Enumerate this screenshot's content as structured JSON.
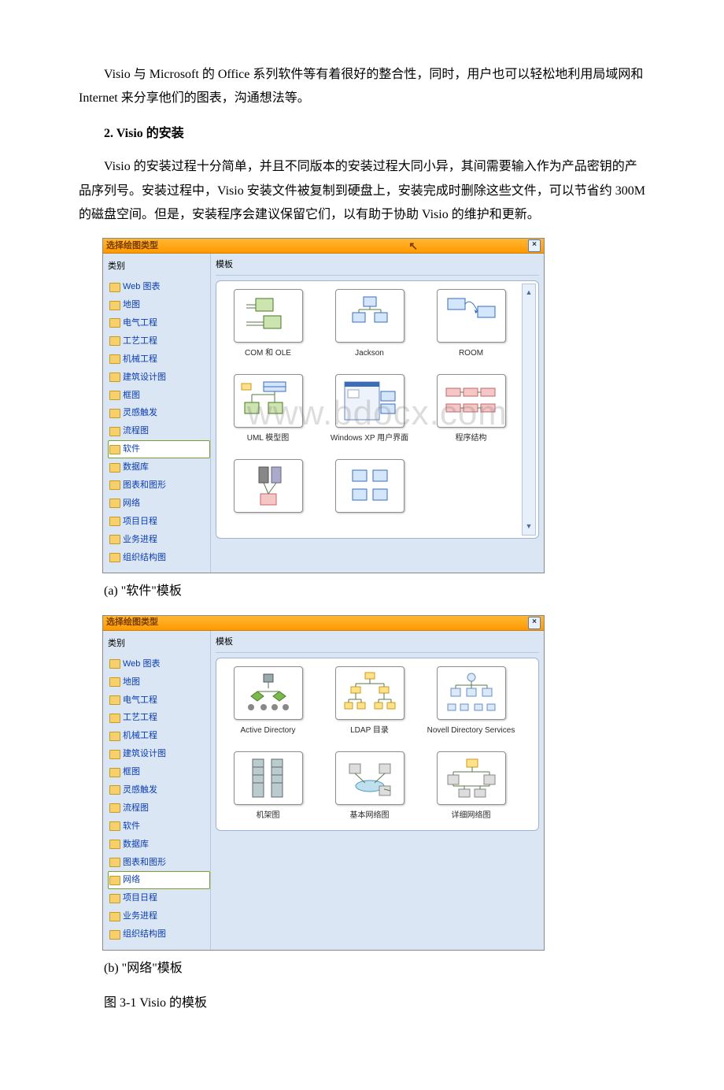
{
  "paragraphs": {
    "p1": "Visio 与 Microsoft 的 Office 系列软件等有着很好的整合性，同时，用户也可以轻松地利用局域网和 Internet 来分享他们的图表，沟通想法等。",
    "heading": "2. Visio 的安装",
    "p2": "Visio 的安装过程十分简单，并且不同版本的安装过程大同小异，其间需要输入作为产品密钥的产品序列号。安装过程中，Visio 安装文件被复制到硬盘上，安装完成时删除这些文件，可以节省约 300M 的磁盘空间。但是，安装程序会建议保留它们，以有助于协助 Visio 的维护和更新。",
    "cap_a": "(a) \"软件\"模板",
    "cap_b": "(b) \"网络\"模板",
    "fig": "图 3-1 Visio 的模板"
  },
  "dialog": {
    "title": "选择绘图类型",
    "close": "×",
    "cat_header": "类别",
    "tpl_header": "模板"
  },
  "categories_a": [
    {
      "label": "Web 图表",
      "sel": false
    },
    {
      "label": "地图",
      "sel": false
    },
    {
      "label": "电气工程",
      "sel": false
    },
    {
      "label": "工艺工程",
      "sel": false
    },
    {
      "label": "机械工程",
      "sel": false
    },
    {
      "label": "建筑设计图",
      "sel": false
    },
    {
      "label": "框图",
      "sel": false
    },
    {
      "label": "灵感触发",
      "sel": false
    },
    {
      "label": "流程图",
      "sel": false
    },
    {
      "label": "软件",
      "sel": true
    },
    {
      "label": "数据库",
      "sel": false
    },
    {
      "label": "图表和图形",
      "sel": false
    },
    {
      "label": "网络",
      "sel": false
    },
    {
      "label": "项目日程",
      "sel": false
    },
    {
      "label": "业务进程",
      "sel": false
    },
    {
      "label": "组织结构图",
      "sel": false
    }
  ],
  "categories_b": [
    {
      "label": "Web 图表",
      "sel": false
    },
    {
      "label": "地图",
      "sel": false
    },
    {
      "label": "电气工程",
      "sel": false
    },
    {
      "label": "工艺工程",
      "sel": false
    },
    {
      "label": "机械工程",
      "sel": false
    },
    {
      "label": "建筑设计图",
      "sel": false
    },
    {
      "label": "框图",
      "sel": false
    },
    {
      "label": "灵感触发",
      "sel": false
    },
    {
      "label": "流程图",
      "sel": false
    },
    {
      "label": "软件",
      "sel": false
    },
    {
      "label": "数据库",
      "sel": false
    },
    {
      "label": "图表和图形",
      "sel": false
    },
    {
      "label": "网络",
      "sel": true
    },
    {
      "label": "项目日程",
      "sel": false
    },
    {
      "label": "业务进程",
      "sel": false
    },
    {
      "label": "组织结构图",
      "sel": false
    }
  ],
  "templates_a": [
    {
      "label": "COM 和 OLE",
      "icon": "com"
    },
    {
      "label": "Jackson",
      "icon": "jackson"
    },
    {
      "label": "ROOM",
      "icon": "room"
    },
    {
      "label": "UML 模型图",
      "icon": "uml"
    },
    {
      "label": "Windows XP 用户界面",
      "icon": "winxp"
    },
    {
      "label": "程序结构",
      "icon": "prog"
    },
    {
      "label": "",
      "icon": "enterprise"
    },
    {
      "label": "",
      "icon": "boxes"
    }
  ],
  "templates_b": [
    {
      "label": "Active Directory",
      "icon": "ad"
    },
    {
      "label": "LDAP 目录",
      "icon": "ldap"
    },
    {
      "label": "Novell Directory Services",
      "icon": "nds"
    },
    {
      "label": "机架图",
      "icon": "rack"
    },
    {
      "label": "基本网络图",
      "icon": "basicnet"
    },
    {
      "label": "详细网络图",
      "icon": "detailnet"
    }
  ],
  "watermark": "www.bdocx.com"
}
